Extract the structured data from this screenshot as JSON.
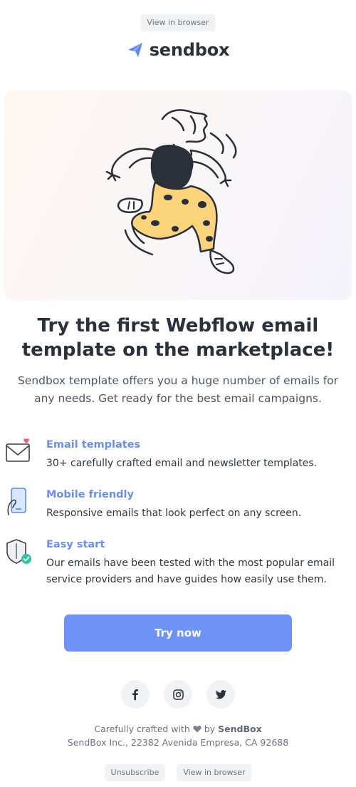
{
  "header": {
    "view_in_browser": "View in browser",
    "brand_name": "sendbox",
    "brand_color": "#5b86f0"
  },
  "hero": {
    "illustration": "dancing-character-illustration"
  },
  "headline": "Try the first Webflow email template on the marketplace!",
  "subheadline": "Sendbox template offers you a huge number of emails for any needs. Get ready for the best email campaigns.",
  "features": [
    {
      "icon": "envelope-heart-icon",
      "title": "Email templates",
      "text": "30+ carefully crafted email and newsletter templates."
    },
    {
      "icon": "mobile-phone-icon",
      "title": "Mobile friendly",
      "text": "Responsive emails that look perfect on any screen."
    },
    {
      "icon": "shield-check-icon",
      "title": "Easy start",
      "text": "Our emails have been tested with the most popular email service providers and have guides how easily use them."
    }
  ],
  "cta": {
    "label": "Try now",
    "color": "#6e93f7"
  },
  "social": [
    {
      "icon": "facebook-icon"
    },
    {
      "icon": "instagram-icon"
    },
    {
      "icon": "twitter-icon"
    }
  ],
  "footer": {
    "crafted_prefix": "Carefully crafted with",
    "crafted_by": "by",
    "brand": "SendBox",
    "address": "SendBox Inc., 22382 Avenida Empresa, CA 92688",
    "unsubscribe": "Unsubscribe",
    "view_in_browser": "View in browser"
  }
}
